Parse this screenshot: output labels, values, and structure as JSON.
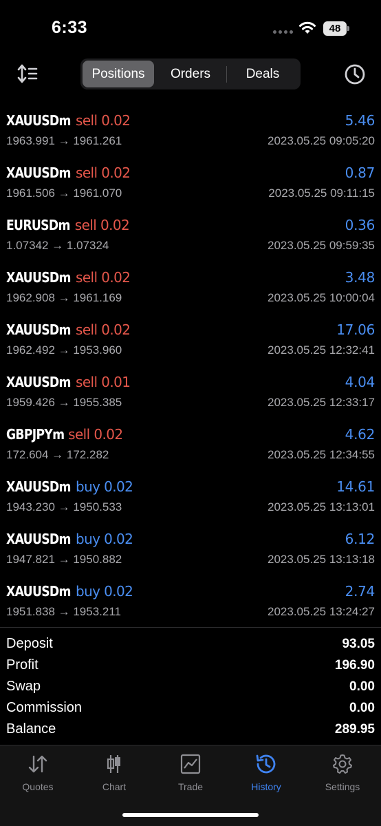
{
  "status": {
    "time": "6:33",
    "battery": "48"
  },
  "tabs_segment": [
    {
      "label": "Positions",
      "active": true
    },
    {
      "label": "Orders",
      "active": false
    },
    {
      "label": "Deals",
      "active": false
    }
  ],
  "trades": [
    {
      "symbol": "XAUUSDm",
      "side": "sell 0.02",
      "type": "sell",
      "profit": "5.46",
      "prices": "1963.991 → 1961.261",
      "time": "2023.05.25 09:05:20"
    },
    {
      "symbol": "XAUUSDm",
      "side": "sell 0.02",
      "type": "sell",
      "profit": "0.87",
      "prices": "1961.506 → 1961.070",
      "time": "2023.05.25 09:11:15"
    },
    {
      "symbol": "EURUSDm",
      "side": "sell 0.02",
      "type": "sell",
      "profit": "0.36",
      "prices": "1.07342 → 1.07324",
      "time": "2023.05.25 09:59:35"
    },
    {
      "symbol": "XAUUSDm",
      "side": "sell 0.02",
      "type": "sell",
      "profit": "3.48",
      "prices": "1962.908 → 1961.169",
      "time": "2023.05.25 10:00:04"
    },
    {
      "symbol": "XAUUSDm",
      "side": "sell 0.02",
      "type": "sell",
      "profit": "17.06",
      "prices": "1962.492 → 1953.960",
      "time": "2023.05.25 12:32:41"
    },
    {
      "symbol": "XAUUSDm",
      "side": "sell 0.01",
      "type": "sell",
      "profit": "4.04",
      "prices": "1959.426 → 1955.385",
      "time": "2023.05.25 12:33:17"
    },
    {
      "symbol": "GBPJPYm",
      "side": "sell 0.02",
      "type": "sell",
      "profit": "4.62",
      "prices": "172.604 → 172.282",
      "time": "2023.05.25 12:34:55"
    },
    {
      "symbol": "XAUUSDm",
      "side": "buy 0.02",
      "type": "buy",
      "profit": "14.61",
      "prices": "1943.230 → 1950.533",
      "time": "2023.05.25 13:13:01"
    },
    {
      "symbol": "XAUUSDm",
      "side": "buy 0.02",
      "type": "buy",
      "profit": "6.12",
      "prices": "1947.821 → 1950.882",
      "time": "2023.05.25 13:13:18"
    },
    {
      "symbol": "XAUUSDm",
      "side": "buy 0.02",
      "type": "buy",
      "profit": "2.74",
      "prices": "1951.838 → 1953.211",
      "time": "2023.05.25 13:24:27"
    }
  ],
  "summary": [
    {
      "label": "Deposit",
      "value": "93.05"
    },
    {
      "label": "Profit",
      "value": "196.90"
    },
    {
      "label": "Swap",
      "value": "0.00"
    },
    {
      "label": "Commission",
      "value": "0.00"
    },
    {
      "label": "Balance",
      "value": "289.95"
    }
  ],
  "tabbar": [
    {
      "label": "Quotes",
      "icon": "quotes-arrows-icon"
    },
    {
      "label": "Chart",
      "icon": "candlestick-icon"
    },
    {
      "label": "Trade",
      "icon": "trade-chart-icon"
    },
    {
      "label": "History",
      "icon": "history-clock-icon",
      "active": true
    },
    {
      "label": "Settings",
      "icon": "gear-icon"
    }
  ],
  "colors": {
    "sell": "#e5574b",
    "buy": "#4a8ef2",
    "profit": "#4a8ef2",
    "active_tab": "#3f83f1"
  }
}
